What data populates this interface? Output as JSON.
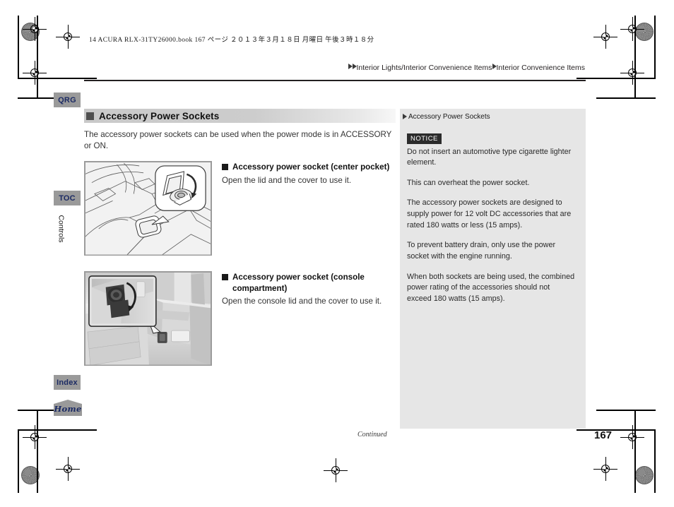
{
  "print_slug": "14 ACURA RLX-31TY26000.book   167 ページ   ２０１３年３月１８日   月曜日   午後３時１８分",
  "breadcrumb": {
    "level1": "Interior Lights/Interior Convenience Items",
    "level2": "Interior Convenience Items"
  },
  "nav": {
    "qrg": "QRG",
    "toc": "TOC",
    "section": "Controls",
    "index": "Index",
    "home": "Home"
  },
  "main": {
    "heading": "Accessory Power Sockets",
    "intro": "The accessory power sockets can be used when the power mode is in ACCESSORY or ON.",
    "sections": [
      {
        "title": "Accessory power socket (center pocket)",
        "title_line2": "",
        "body": "Open the lid and the cover to use it.",
        "figure_alt": "center-pocket-power-socket-illustration"
      },
      {
        "title": "Accessory power socket (console",
        "title_line2": "compartment)",
        "body": "Open the console lid and the cover to use it.",
        "figure_alt": "console-compartment-power-socket-photo"
      }
    ]
  },
  "aside": {
    "title": "Accessory Power Sockets",
    "notice_label": "NOTICE",
    "paragraphs": [
      "Do not insert an automotive type cigarette lighter element.",
      "This can overheat the power socket.",
      "The accessory power sockets are designed to supply power for 12 volt DC accessories that are rated 180 watts or less (15 amps).",
      "To prevent battery drain, only use the power socket with the engine running.",
      "When both sockets are being used, the combined power rating of the accessories should not exceed 180 watts (15 amps)."
    ]
  },
  "footer": {
    "continued": "Continued",
    "page_number": "167"
  },
  "colors": {
    "tab_gray": "#9a9a9a",
    "tab_text": "#1b2a63",
    "aside_bg": "#e6e6e6",
    "notice_bg": "#2b2b2b",
    "heading_bar": "#c9c9c9"
  }
}
